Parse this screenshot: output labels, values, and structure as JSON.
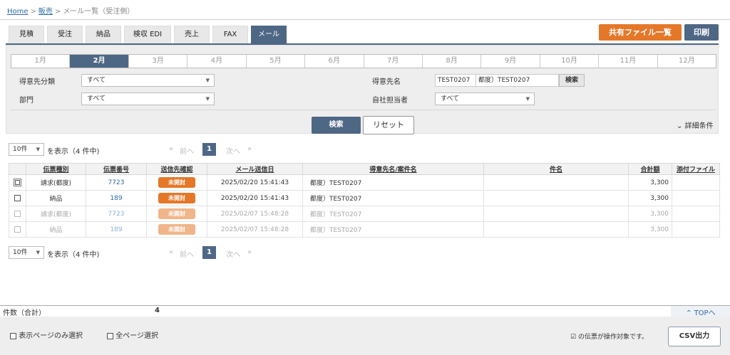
{
  "breadcrumb": {
    "home": "Home",
    "sep": ">",
    "sales": "販売",
    "current": "メール一覧（受注側）"
  },
  "tabs": [
    "見積",
    "受注",
    "納品",
    "検収 EDI",
    "売上",
    "FAX",
    "メール"
  ],
  "active_tab": "メール",
  "actions": {
    "shared_files": "共有ファイル一覧",
    "print": "印刷"
  },
  "months": [
    "1月",
    "2月",
    "3月",
    "4月",
    "5月",
    "6月",
    "7月",
    "8月",
    "9月",
    "10月",
    "11月",
    "12月"
  ],
  "active_month": "2月",
  "filters": {
    "customer_category": {
      "label": "得意先分類",
      "value": "すべて"
    },
    "department": {
      "label": "部門",
      "value": "すべて"
    },
    "customer_name": {
      "label": "得意先名",
      "code": "TEST0207",
      "name": "都度）TEST0207",
      "search": "検索"
    },
    "staff": {
      "label": "自社担当者",
      "value": "すべて"
    }
  },
  "search_button": "検索",
  "reset_button": "リセット",
  "detail_toggle": "詳細条件",
  "pager": {
    "page_size": "10件",
    "summary": "を表示（4 件中)",
    "first": "«",
    "prev": "前へ",
    "current": "1",
    "next": "次へ",
    "last": "»"
  },
  "columns": [
    "",
    "伝票種別",
    "伝票番号",
    "送信先確認",
    "メール送信日",
    "得意先名/案件名",
    "件名",
    "合計額",
    "添付ファイル"
  ],
  "rows": [
    {
      "type": "請求(都度)",
      "number": "7723",
      "status": "未開封",
      "sent": "2025/02/20 15:41:43",
      "customer": "都度）TEST0207",
      "subject": "",
      "total": "3,300",
      "attachment": ""
    },
    {
      "type": "納品",
      "number": "189",
      "status": "未開封",
      "sent": "2025/02/20 15:41:43",
      "customer": "都度）TEST0207",
      "subject": "",
      "total": "3,300",
      "attachment": ""
    },
    {
      "type": "請求(都度)",
      "number": "7723",
      "status": "未開封",
      "sent": "2025/02/07 15:48:28",
      "customer": "都度）TEST0207",
      "subject": "",
      "total": "3,300",
      "attachment": ""
    },
    {
      "type": "納品",
      "number": "189",
      "status": "未開封",
      "sent": "2025/02/07 15:48:28",
      "customer": "都度）TEST0207",
      "subject": "",
      "total": "3,300",
      "attachment": ""
    }
  ],
  "footer": {
    "count_label": "件数（合計）",
    "count_value": "4",
    "top_link": "TOPへ",
    "select_page": "表示ページのみ選択",
    "select_all": "全ページ選択",
    "target_note": "の伝票が操作対象です。",
    "csv": "CSV出力"
  },
  "colors": {
    "navy": "#4e6785",
    "orange": "#e57729",
    "link": "#2a6aa8"
  }
}
